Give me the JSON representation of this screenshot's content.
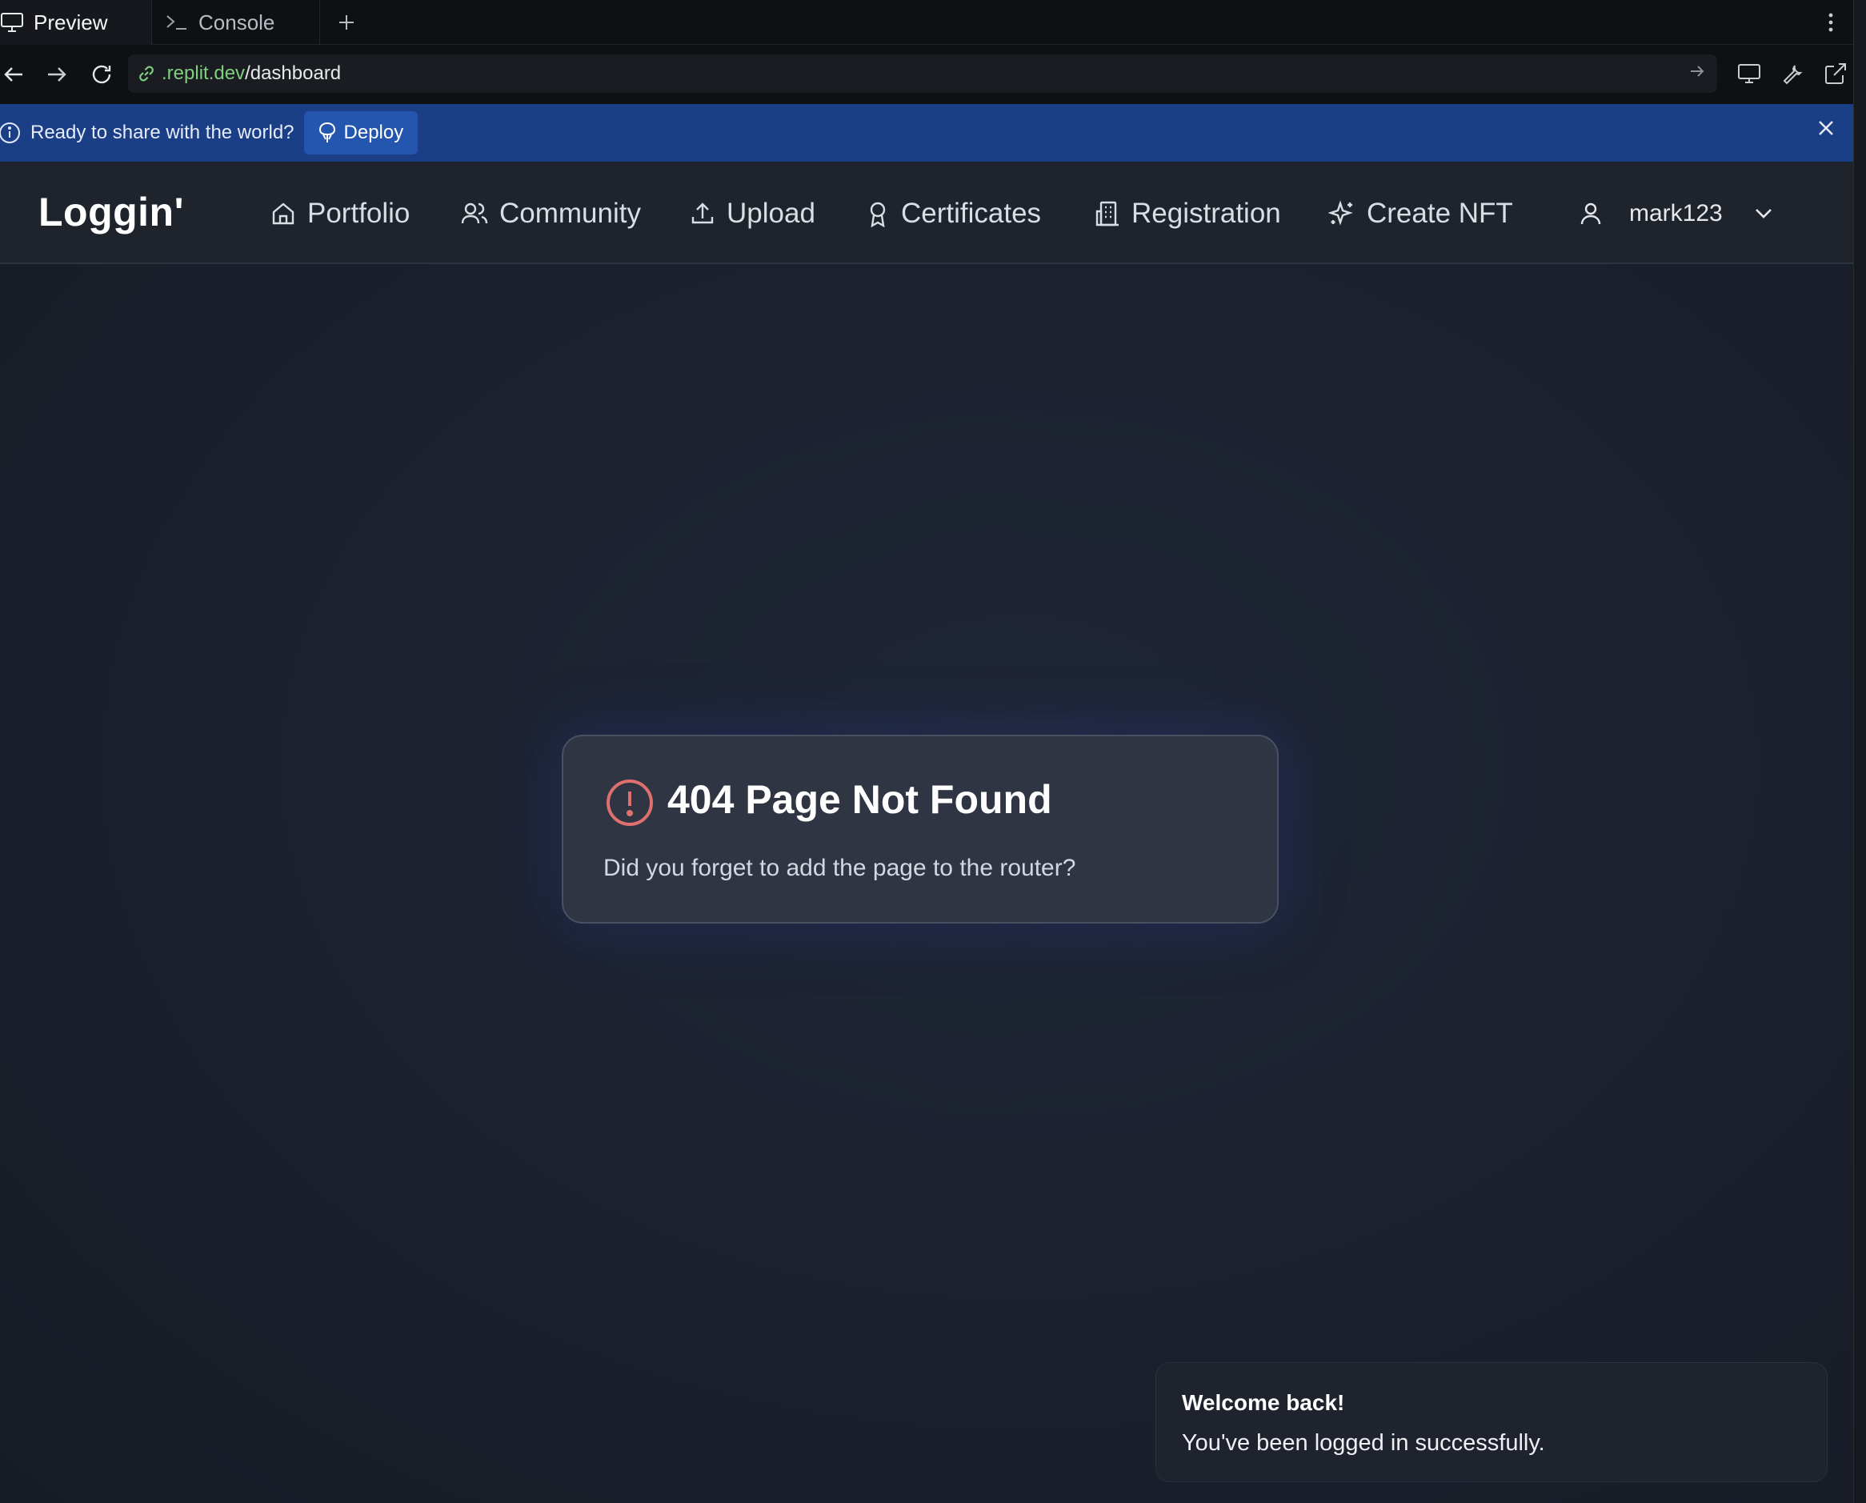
{
  "browser": {
    "tabs": [
      {
        "label": "Preview",
        "icon": "monitor-icon"
      },
      {
        "label": "Console",
        "icon": "terminal-icon"
      }
    ],
    "address": {
      "host": ".replit.dev",
      "path": "/dashboard"
    }
  },
  "banner": {
    "message": "Ready to share with the world?",
    "deploy_label": "Deploy",
    "background": "#1a3f86"
  },
  "app": {
    "logo": "Loggin'",
    "nav": [
      {
        "label": "Portfolio",
        "icon": "home-icon"
      },
      {
        "label": "Community",
        "icon": "users-icon"
      },
      {
        "label": "Upload",
        "icon": "upload-icon"
      },
      {
        "label": "Certificates",
        "icon": "award-icon"
      },
      {
        "label": "Registration",
        "icon": "building-icon"
      },
      {
        "label": "Create NFT",
        "icon": "sparkles-icon"
      }
    ],
    "user": {
      "name": "mark123",
      "icon": "user-icon"
    }
  },
  "error_card": {
    "title": "404 Page Not Found",
    "description": "Did you forget to add the page to the router?",
    "accent": "#e0706f"
  },
  "toast": {
    "title": "Welcome back!",
    "description": "You've been logged in successfully."
  }
}
